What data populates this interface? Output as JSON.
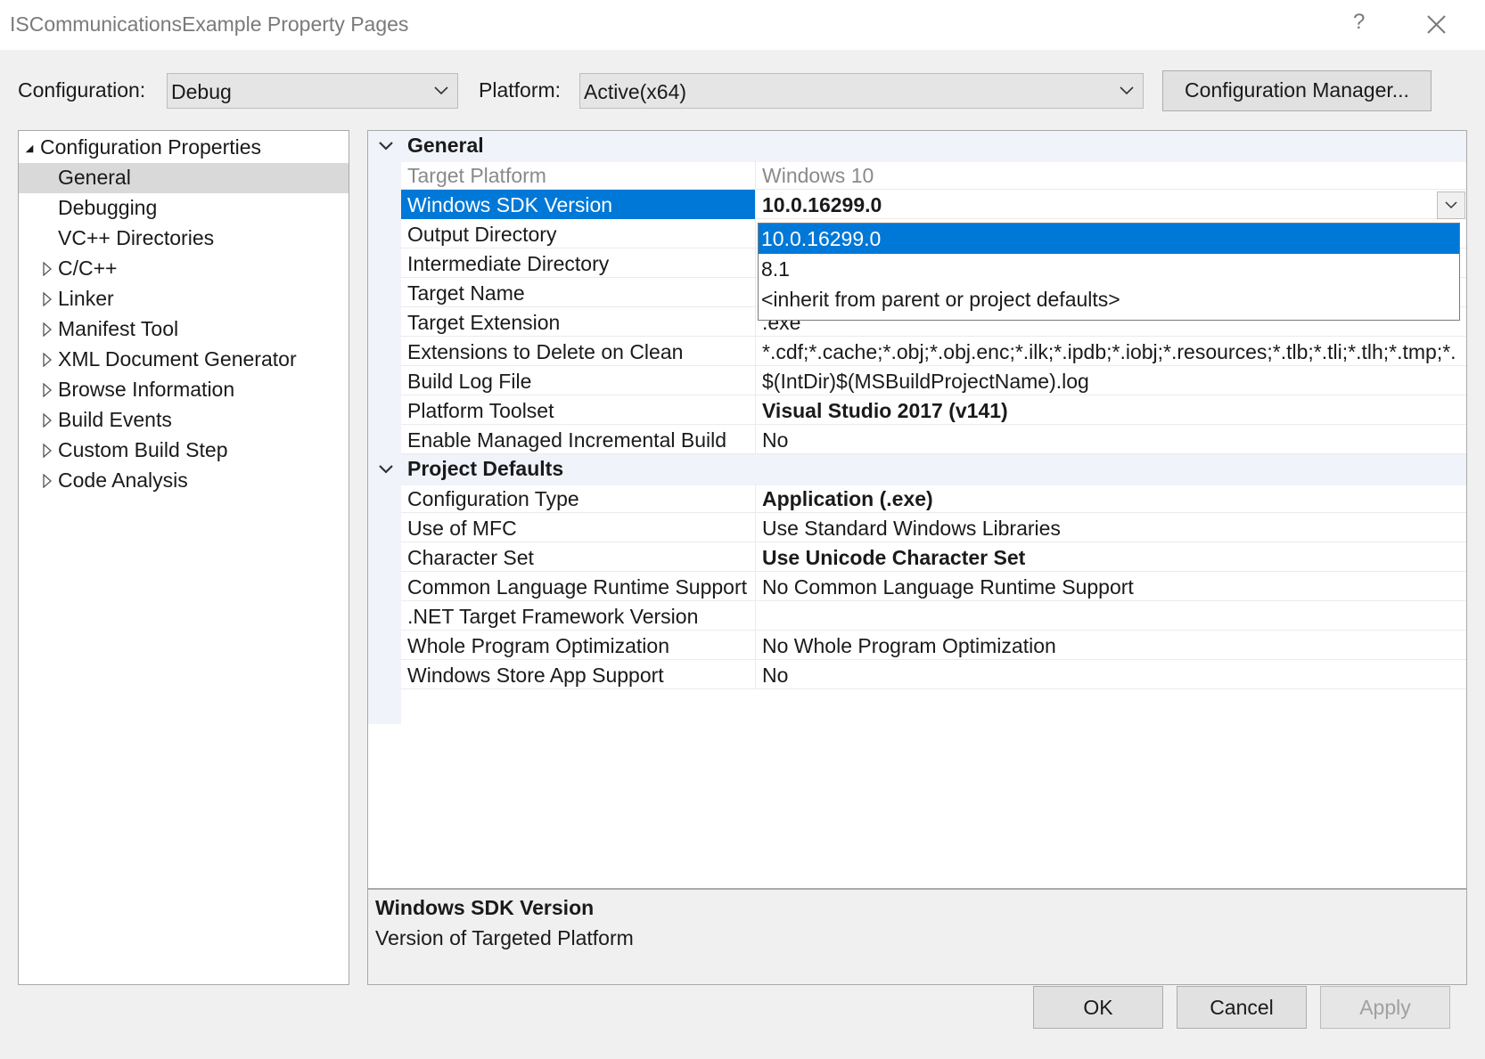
{
  "window": {
    "title": "ISCommunicationsExample Property Pages",
    "help_label": "?"
  },
  "toolbar": {
    "configuration_label": "Configuration:",
    "configuration_value": "Debug",
    "platform_label": "Platform:",
    "platform_value": "Active(x64)",
    "config_manager_label": "Configuration Manager..."
  },
  "tree": {
    "root": "Configuration Properties",
    "items": [
      {
        "label": "General",
        "selected": true,
        "expandable": false
      },
      {
        "label": "Debugging",
        "selected": false,
        "expandable": false
      },
      {
        "label": "VC++ Directories",
        "selected": false,
        "expandable": false
      },
      {
        "label": "C/C++",
        "selected": false,
        "expandable": true
      },
      {
        "label": "Linker",
        "selected": false,
        "expandable": true
      },
      {
        "label": "Manifest Tool",
        "selected": false,
        "expandable": true
      },
      {
        "label": "XML Document Generator",
        "selected": false,
        "expandable": true
      },
      {
        "label": "Browse Information",
        "selected": false,
        "expandable": true
      },
      {
        "label": "Build Events",
        "selected": false,
        "expandable": true
      },
      {
        "label": "Custom Build Step",
        "selected": false,
        "expandable": true
      },
      {
        "label": "Code Analysis",
        "selected": false,
        "expandable": true
      }
    ]
  },
  "grid": {
    "categories": [
      {
        "title": "General",
        "rows": [
          {
            "name": "Target Platform",
            "value": "Windows 10",
            "bold": false,
            "dim": true
          },
          {
            "name": "Windows SDK Version",
            "value": "10.0.16299.0",
            "bold": true,
            "selected": true
          },
          {
            "name": "Output Directory",
            "value": "",
            "bold": false
          },
          {
            "name": "Intermediate Directory",
            "value": "",
            "bold": false
          },
          {
            "name": "Target Name",
            "value": "",
            "bold": false
          },
          {
            "name": "Target Extension",
            "value": ".exe",
            "bold": false
          },
          {
            "name": "Extensions to Delete on Clean",
            "value": "*.cdf;*.cache;*.obj;*.obj.enc;*.ilk;*.ipdb;*.iobj;*.resources;*.tlb;*.tli;*.tlh;*.tmp;*.",
            "bold": false
          },
          {
            "name": "Build Log File",
            "value": "$(IntDir)$(MSBuildProjectName).log",
            "bold": false
          },
          {
            "name": "Platform Toolset",
            "value": "Visual Studio 2017 (v141)",
            "bold": true
          },
          {
            "name": "Enable Managed Incremental Build",
            "value": "No",
            "bold": false
          }
        ]
      },
      {
        "title": "Project Defaults",
        "rows": [
          {
            "name": "Configuration Type",
            "value": "Application (.exe)",
            "bold": true
          },
          {
            "name": "Use of MFC",
            "value": "Use Standard Windows Libraries",
            "bold": false
          },
          {
            "name": "Character Set",
            "value": "Use Unicode Character Set",
            "bold": true
          },
          {
            "name": "Common Language Runtime Support",
            "value": "No Common Language Runtime Support",
            "bold": false
          },
          {
            "name": ".NET Target Framework Version",
            "value": "",
            "bold": false
          },
          {
            "name": "Whole Program Optimization",
            "value": "No Whole Program Optimization",
            "bold": false
          },
          {
            "name": "Windows Store App Support",
            "value": "No",
            "bold": false
          }
        ]
      }
    ]
  },
  "dropdown": {
    "options": [
      {
        "label": "10.0.16299.0",
        "highlighted": true
      },
      {
        "label": "8.1",
        "highlighted": false
      },
      {
        "label": "<inherit from parent or project defaults>",
        "highlighted": false
      }
    ]
  },
  "description": {
    "title": "Windows SDK Version",
    "text": "Version of Targeted Platform"
  },
  "buttons": {
    "ok": "OK",
    "cancel": "Cancel",
    "apply": "Apply"
  },
  "colors": {
    "selection": "#0078d7",
    "category_bg": "#f0f3f9",
    "window_bg": "#f0f0f0"
  }
}
